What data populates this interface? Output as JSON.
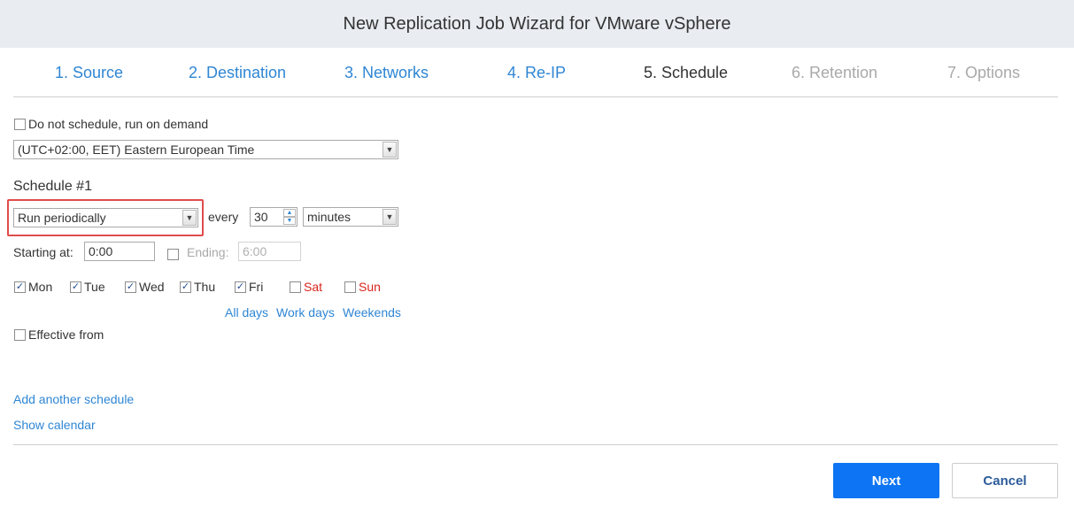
{
  "window": {
    "title": "New Replication Job Wizard for VMware vSphere"
  },
  "steps": [
    {
      "label": "1. Source",
      "state": "done"
    },
    {
      "label": "2. Destination",
      "state": "done"
    },
    {
      "label": "3. Networks",
      "state": "done"
    },
    {
      "label": "4. Re-IP",
      "state": "done"
    },
    {
      "label": "5. Schedule",
      "state": "current"
    },
    {
      "label": "6. Retention",
      "state": "future"
    },
    {
      "label": "7. Options",
      "state": "future"
    }
  ],
  "on_demand": {
    "label": "Do not schedule, run on demand",
    "checked": false
  },
  "timezone": {
    "value": "(UTC+02:00, EET) Eastern European Time"
  },
  "schedule": {
    "heading": "Schedule #1",
    "mode": "Run periodically",
    "every_label": "every",
    "interval": "30",
    "unit": "minutes",
    "starting_label": "Starting at:",
    "starting_value": "0:00",
    "ending_label": "Ending:",
    "ending_value": "6:00",
    "ending_checked": false,
    "days": [
      {
        "label": "Mon",
        "checked": true
      },
      {
        "label": "Tue",
        "checked": true
      },
      {
        "label": "Wed",
        "checked": true
      },
      {
        "label": "Thu",
        "checked": true
      },
      {
        "label": "Fri",
        "checked": true
      },
      {
        "label": "Sat",
        "checked": false
      },
      {
        "label": "Sun",
        "checked": false
      }
    ],
    "day_shortcuts": [
      "All days",
      "Work days",
      "Weekends"
    ],
    "effective_from": {
      "label": "Effective from",
      "checked": false
    }
  },
  "links": {
    "add_schedule": "Add another schedule",
    "show_calendar": "Show calendar"
  },
  "buttons": {
    "next": "Next",
    "cancel": "Cancel"
  },
  "colors": {
    "link": "#2f86d4",
    "primary": "#0d75f3",
    "weekend": "#d9251d",
    "highlight": "#e04c4c"
  }
}
